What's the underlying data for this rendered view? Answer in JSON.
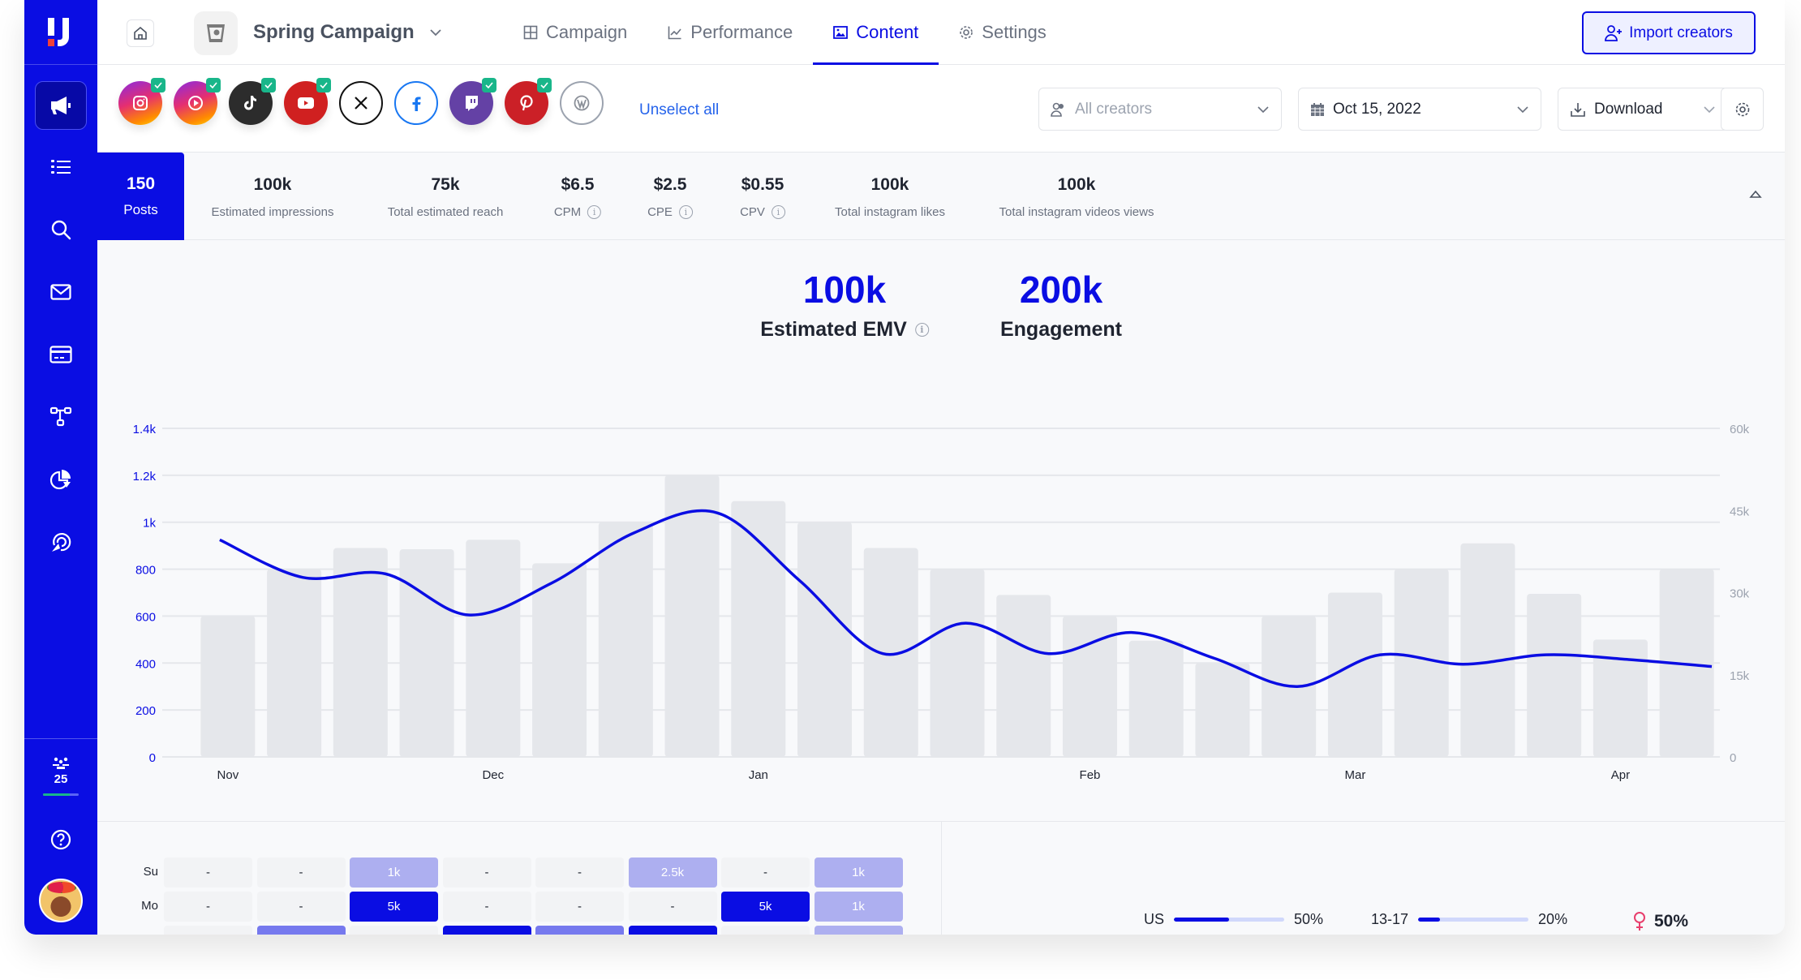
{
  "sidebar": {
    "items": [
      {
        "name": "campaigns",
        "icon": "megaphone-icon",
        "active": true
      },
      {
        "name": "lists",
        "icon": "list-icon",
        "active": false
      },
      {
        "name": "search",
        "icon": "search-icon",
        "active": false
      },
      {
        "name": "inbox",
        "icon": "mail-icon",
        "active": false
      },
      {
        "name": "payments",
        "icon": "credit-card-icon",
        "active": false
      },
      {
        "name": "workflows",
        "icon": "workflow-icon",
        "active": false
      },
      {
        "name": "reports",
        "icon": "pie-chart-icon",
        "active": false
      },
      {
        "name": "tracking",
        "icon": "tracking-icon",
        "active": false
      }
    ],
    "creators_count": "25",
    "creators_progress": 0.75,
    "help_icon": "help-icon",
    "avatar": "user-avatar"
  },
  "header": {
    "campaign_title": "Spring Campaign",
    "tabs": [
      {
        "label": "Campaign",
        "icon": "grid-icon",
        "active": false
      },
      {
        "label": "Performance",
        "icon": "line-chart-icon",
        "active": false
      },
      {
        "label": "Content",
        "icon": "image-icon",
        "active": true
      },
      {
        "label": "Settings",
        "icon": "gear-icon",
        "active": false
      }
    ],
    "import_button": "Import creators"
  },
  "filters": {
    "platforms": [
      {
        "name": "instagram",
        "selected": true
      },
      {
        "name": "instagram-reels",
        "selected": true
      },
      {
        "name": "tiktok",
        "selected": true
      },
      {
        "name": "youtube",
        "selected": true
      },
      {
        "name": "x",
        "selected": false
      },
      {
        "name": "facebook",
        "selected": false
      },
      {
        "name": "twitch",
        "selected": true
      },
      {
        "name": "pinterest",
        "selected": true
      },
      {
        "name": "wordpress",
        "selected": false
      }
    ],
    "unselect_all": "Unselect all",
    "creators_placeholder": "All creators",
    "date": "Oct 15, 2022",
    "download": "Download"
  },
  "stats": {
    "posts": {
      "value": "150",
      "label": "Posts"
    },
    "items": [
      {
        "value": "100k",
        "label": "Estimated impressions",
        "info": false
      },
      {
        "value": "75k",
        "label": "Total estimated reach",
        "info": false
      },
      {
        "value": "$6.5",
        "label": "CPM",
        "info": true
      },
      {
        "value": "$2.5",
        "label": "CPE",
        "info": true
      },
      {
        "value": "$0.55",
        "label": "CPV",
        "info": true
      },
      {
        "value": "100k",
        "label": "Total instagram likes",
        "info": false
      },
      {
        "value": "100k",
        "label": "Total instagram videos views",
        "info": false
      }
    ]
  },
  "kpis": [
    {
      "value": "100k",
      "label": "Estimated EMV",
      "info": true
    },
    {
      "value": "200k",
      "label": "Engagement",
      "info": false
    }
  ],
  "chart_data": {
    "type": "bar",
    "title": "",
    "xlabel": "",
    "ylabel": "",
    "x_tick_labels": [
      {
        "label": "Nov",
        "index": 1.5
      },
      {
        "label": "Dec",
        "index": 5.5
      },
      {
        "label": "Jan",
        "index": 9.5
      },
      {
        "label": "Feb",
        "index": 14.5
      },
      {
        "label": "Mar",
        "index": 18.5
      },
      {
        "label": "Apr",
        "index": 22.5
      }
    ],
    "ylim": [
      0,
      1400
    ],
    "yticks": [
      0,
      200,
      400,
      600,
      800,
      1000,
      1200,
      1400
    ],
    "ytick_labels": [
      "0",
      "200",
      "400",
      "600",
      "800",
      "1k",
      "1.2k",
      "1.4k"
    ],
    "y2lim": [
      0,
      60000
    ],
    "y2ticks": [
      0,
      15000,
      30000,
      45000,
      60000
    ],
    "y2tick_labels": [
      "0",
      "15k",
      "30k",
      "45k",
      "60k"
    ],
    "grid": true,
    "series": [
      {
        "name": "bars",
        "type": "bar",
        "axis": "left",
        "color": "#e5e7eb",
        "values": [
          600,
          800,
          890,
          885,
          925,
          825,
          1000,
          1200,
          1090,
          1000,
          890,
          800,
          690,
          600,
          495,
          400,
          600,
          700,
          800,
          910,
          695,
          500,
          800
        ]
      },
      {
        "name": "line",
        "type": "line",
        "axis": "left",
        "color": "#0a0de3",
        "values": [
          925,
          765,
          780,
          605,
          740,
          955,
          1040,
          750,
          440,
          570,
          440,
          530,
          420,
          300,
          435,
          395,
          435,
          415,
          385
        ]
      }
    ]
  },
  "heatmap": {
    "rows": [
      {
        "label": "Su",
        "cells": [
          {
            "text": "-",
            "level": 0
          },
          {
            "text": "-",
            "level": 0
          },
          {
            "text": "1k",
            "level": 1
          },
          {
            "text": "-",
            "level": 0
          },
          {
            "text": "-",
            "level": 0
          },
          {
            "text": "2.5k",
            "level": 1
          },
          {
            "text": "-",
            "level": 0
          },
          {
            "text": "1k",
            "level": 1
          }
        ]
      },
      {
        "label": "Mo",
        "cells": [
          {
            "text": "-",
            "level": 0
          },
          {
            "text": "-",
            "level": 0
          },
          {
            "text": "5k",
            "level": 3
          },
          {
            "text": "-",
            "level": 0
          },
          {
            "text": "-",
            "level": 0
          },
          {
            "text": "-",
            "level": 0
          },
          {
            "text": "5k",
            "level": 3
          },
          {
            "text": "1k",
            "level": 1
          }
        ]
      },
      {
        "label": "",
        "cells": [
          {
            "text": "",
            "level": 0
          },
          {
            "text": "",
            "level": 2
          },
          {
            "text": "",
            "level": 0
          },
          {
            "text": "",
            "level": 3
          },
          {
            "text": "",
            "level": 2
          },
          {
            "text": "",
            "level": 3
          },
          {
            "text": "",
            "level": 0
          },
          {
            "text": "",
            "level": 1
          }
        ]
      }
    ],
    "level_colors": [
      "#f2f3f5",
      "#adaff0",
      "#7679ee",
      "#0a0de3"
    ]
  },
  "demographics": {
    "country": {
      "label": "US",
      "value": "50%",
      "fraction": 0.5
    },
    "age": {
      "label": "13-17",
      "value": "20%",
      "fraction": 0.2
    },
    "gender": {
      "icon": "female-icon",
      "value": "50%"
    }
  }
}
